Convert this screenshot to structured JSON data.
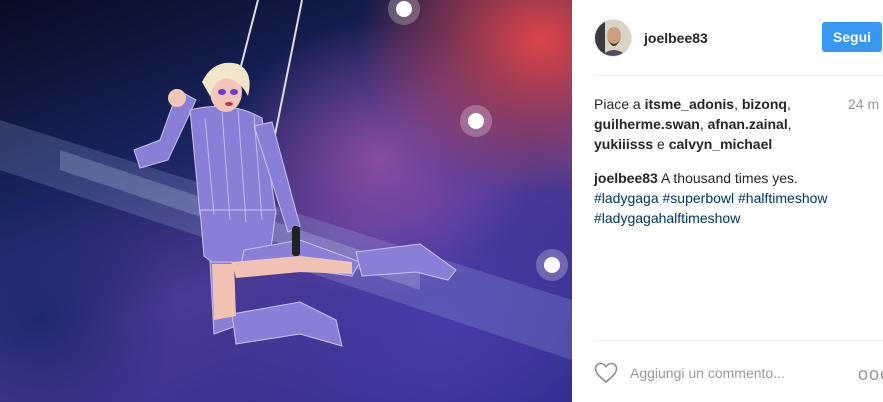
{
  "post": {
    "photo": {
      "icon": "performer-photo"
    },
    "author": {
      "username": "joelbee83",
      "avatar_icon": "user-avatar"
    },
    "follow_label": "Segui",
    "likes": {
      "prefix": "Piace a",
      "users": [
        "itsme_adonis",
        "bizonq",
        "guilherme.swan",
        "afnan.zainal",
        "yukiiisss",
        "calvyn_michael"
      ],
      "sep": ", ",
      "and": "e"
    },
    "time": "24 m",
    "caption": {
      "username": "joelbee83",
      "text": "A thousand times yes.",
      "hashtags": [
        "#ladygaga",
        "#superbowl",
        "#halftimeshow",
        "#ladygagahalftimeshow"
      ]
    },
    "comment": {
      "placeholder": "Aggiungi un commento...",
      "like_icon": "heart-icon",
      "more_icon": "more-options-icon",
      "more_label": "ooo"
    }
  },
  "colors": {
    "accent": "#3897f0",
    "hashtag": "#003569",
    "muted": "#999999",
    "text": "#262626"
  }
}
